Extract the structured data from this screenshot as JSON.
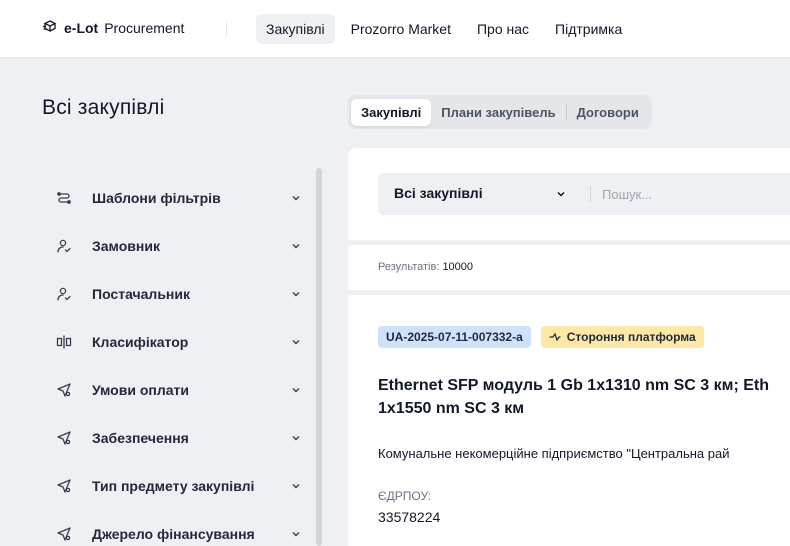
{
  "header": {
    "logo_bold": "e-Lot",
    "logo_text": "Procurement",
    "nav": [
      {
        "label": "Закупівлі",
        "active": true
      },
      {
        "label": "Prozorro Market",
        "active": false
      },
      {
        "label": "Про нас",
        "active": false
      },
      {
        "label": "Підтримка",
        "active": false
      }
    ]
  },
  "page": {
    "title": "Всі закупівлі"
  },
  "tabs": [
    {
      "label": "Закупівлі",
      "active": true
    },
    {
      "label": "Плани закупівель",
      "active": false
    },
    {
      "label": "Договори",
      "active": false
    }
  ],
  "filters": [
    {
      "label": "Шаблони фільтрів",
      "icon": "filter-template-icon"
    },
    {
      "label": "Замовник",
      "icon": "user-check-icon"
    },
    {
      "label": "Постачальник",
      "icon": "user-check-icon"
    },
    {
      "label": "Класифікатор",
      "icon": "classifier-icon"
    },
    {
      "label": "Умови оплати",
      "icon": "send-icon"
    },
    {
      "label": "Забезпечення",
      "icon": "send-icon"
    },
    {
      "label": "Тип предмету закупівлі",
      "icon": "send-icon"
    },
    {
      "label": "Джерело фінансування",
      "icon": "send-icon"
    }
  ],
  "search": {
    "select_value": "Всі закупівлі",
    "placeholder": "Пошук..."
  },
  "results": {
    "label": "Результатів:",
    "count": "10000"
  },
  "lot": {
    "id": "UA-2025-07-11-007332-a",
    "platform_badge": "Стороння платформа",
    "title_line1": "Ethernet SFP модуль 1 Gb 1x1310 nm SC 3 км; Eth",
    "title_line2": "1x1550 nm SC 3 км",
    "customer": "Комунальне некомерційне підприємство \"Центральна рай",
    "edrpou_label": "ЄДРПОУ:",
    "edrpou": "33578224"
  },
  "colors": {
    "page_bg": "#eef0f3",
    "badge_id_bg": "#cfe2fb",
    "badge_platform_bg": "#fde8a8"
  }
}
